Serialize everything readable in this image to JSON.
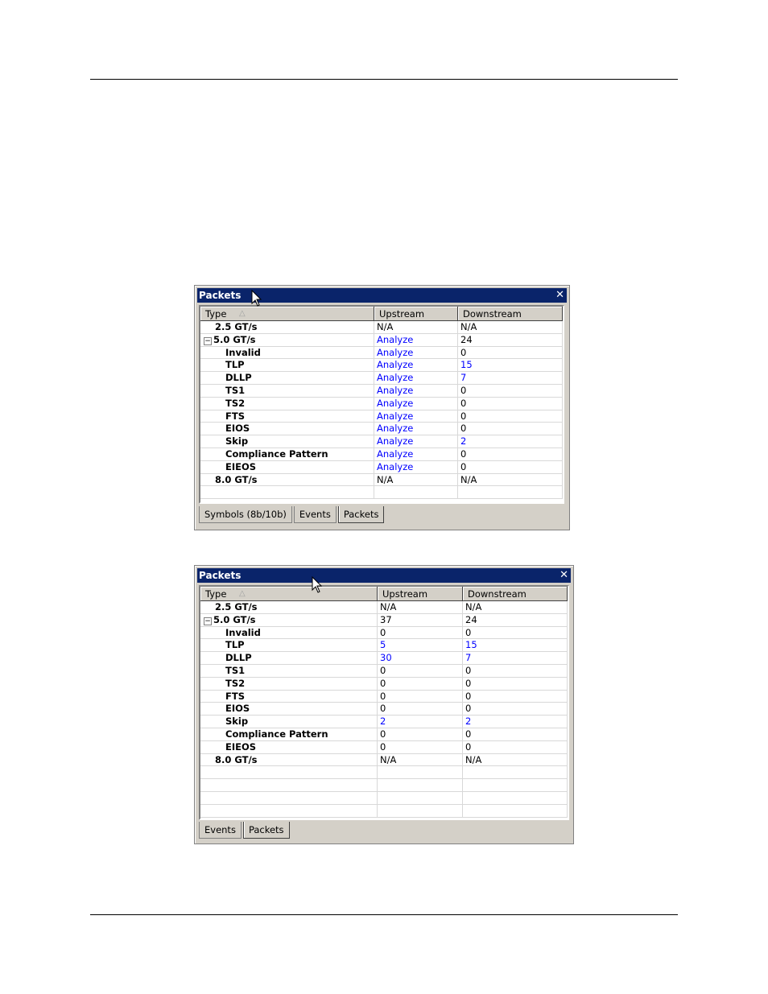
{
  "panel1": {
    "title": "Packets",
    "close": "✕",
    "columns": [
      "Type",
      "Upstream",
      "Downstream"
    ],
    "rows": [
      {
        "type": "2.5 GT/s",
        "up": "N/A",
        "down": "N/A"
      },
      {
        "type": "5.0 GT/s",
        "up": "Analyze",
        "down": "24",
        "expander": "−"
      },
      {
        "type": "Invalid",
        "up": "Analyze",
        "down": "0"
      },
      {
        "type": "TLP",
        "up": "Analyze",
        "down": "15"
      },
      {
        "type": "DLLP",
        "up": "Analyze",
        "down": "7"
      },
      {
        "type": "TS1",
        "up": "Analyze",
        "down": "0"
      },
      {
        "type": "TS2",
        "up": "Analyze",
        "down": "0"
      },
      {
        "type": "FTS",
        "up": "Analyze",
        "down": "0"
      },
      {
        "type": "EIOS",
        "up": "Analyze",
        "down": "0"
      },
      {
        "type": "Skip",
        "up": "Analyze",
        "down": "2"
      },
      {
        "type": "Compliance Pattern",
        "up": "Analyze",
        "down": "0"
      },
      {
        "type": "EIEOS",
        "up": "Analyze",
        "down": "0"
      },
      {
        "type": "8.0 GT/s",
        "up": "N/A",
        "down": "N/A"
      },
      {
        "type": "",
        "up": "",
        "down": ""
      }
    ],
    "tabs": [
      "Symbols (8b/10b)",
      "Events",
      "Packets"
    ]
  },
  "panel2": {
    "title": "Packets",
    "close": "✕",
    "columns": [
      "Type",
      "Upstream",
      "Downstream"
    ],
    "rows": [
      {
        "type": "2.5 GT/s",
        "up": "N/A",
        "down": "N/A"
      },
      {
        "type": "5.0 GT/s",
        "up": "37",
        "down": "24",
        "expander": "−"
      },
      {
        "type": "Invalid",
        "up": "0",
        "down": "0"
      },
      {
        "type": "TLP",
        "up": "5",
        "down": "15"
      },
      {
        "type": "DLLP",
        "up": "30",
        "down": "7"
      },
      {
        "type": "TS1",
        "up": "0",
        "down": "0"
      },
      {
        "type": "TS2",
        "up": "0",
        "down": "0"
      },
      {
        "type": "FTS",
        "up": "0",
        "down": "0"
      },
      {
        "type": "EIOS",
        "up": "0",
        "down": "0"
      },
      {
        "type": "Skip",
        "up": "2",
        "down": "2"
      },
      {
        "type": "Compliance Pattern",
        "up": "0",
        "down": "0"
      },
      {
        "type": "EIEOS",
        "up": "0",
        "down": "0"
      },
      {
        "type": "8.0 GT/s",
        "up": "N/A",
        "down": "N/A"
      },
      {
        "type": "",
        "up": "",
        "down": ""
      },
      {
        "type": "",
        "up": "",
        "down": ""
      },
      {
        "type": "",
        "up": "",
        "down": ""
      },
      {
        "type": "",
        "up": "",
        "down": ""
      }
    ],
    "tabs": [
      "Events",
      "Packets"
    ]
  },
  "colors": {
    "titlebar": "#0a246a",
    "link": "#0000ff",
    "chrome": "#d4d0c8"
  }
}
